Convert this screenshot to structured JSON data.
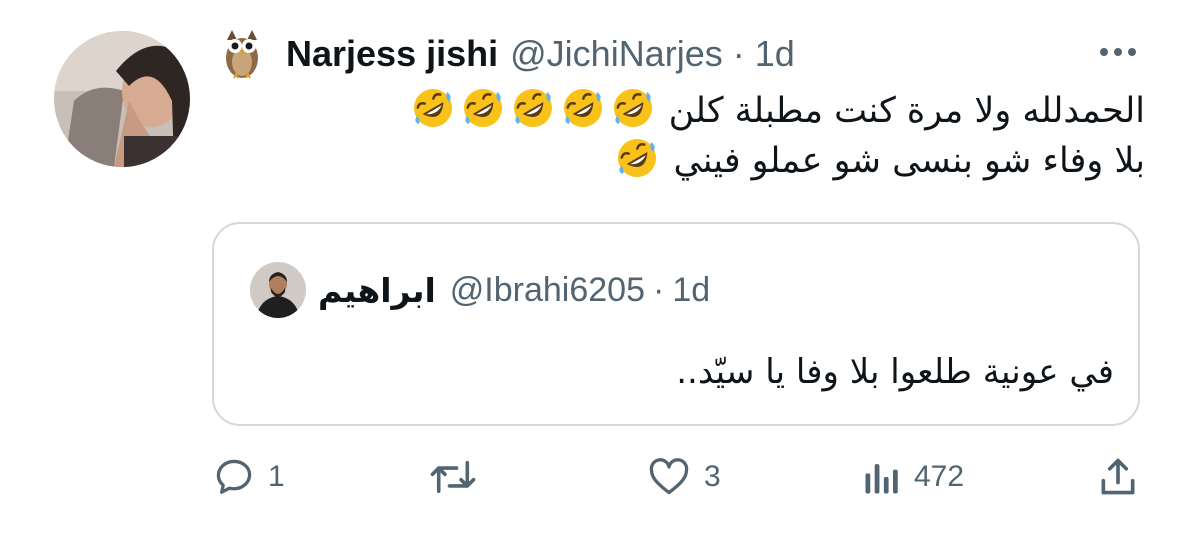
{
  "tweet": {
    "author": {
      "display_name": "Narjess jishi",
      "handle": "@JichiNarjes",
      "badge_icon": "owl-emoji-icon"
    },
    "separator": "·",
    "time": "1d",
    "text_lines": [
      "الحمدلله ولا مرة كنت مطبلة كلن",
      "بلا وفاء شو بنسى شو عملو فيني"
    ],
    "emoji": "rolling-on-floor-laughing-emoji"
  },
  "quote": {
    "author": {
      "display_name": "ابراهيم",
      "handle": "@Ibrahi6205"
    },
    "separator": "·",
    "time": "1d",
    "text": "في عونية طلعوا بلا وفا يا سيّد.."
  },
  "actions": {
    "reply_count": "1",
    "retweet_count": "",
    "like_count": "3",
    "view_count": "472"
  },
  "colors": {
    "text_primary": "#0f1419",
    "text_secondary": "#536471",
    "border": "#cfd9de",
    "emoji_face": "#f9c21b"
  }
}
